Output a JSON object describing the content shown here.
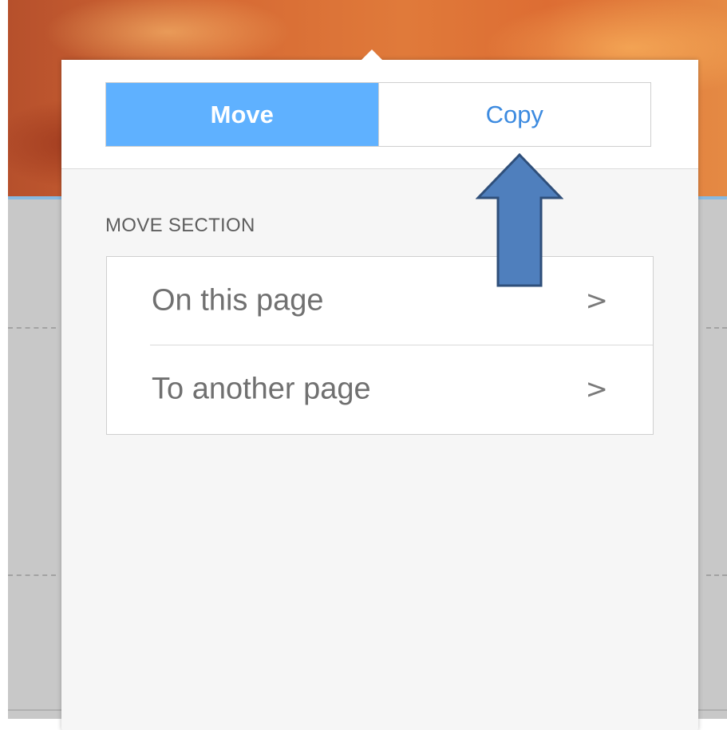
{
  "segmented_control": {
    "move_label": "Move",
    "copy_label": "Copy",
    "selected": "Move"
  },
  "section": {
    "label": "MOVE SECTION"
  },
  "options": [
    {
      "label": "On this page",
      "chevron": ">"
    },
    {
      "label": "To another page",
      "chevron": ">"
    }
  ],
  "colors": {
    "accent": "#5fb1ff",
    "link": "#3d8be0",
    "annotation_arrow": "#4f7fbd"
  },
  "annotation": {
    "icon": "up-arrow-icon",
    "points_to": "Copy"
  }
}
